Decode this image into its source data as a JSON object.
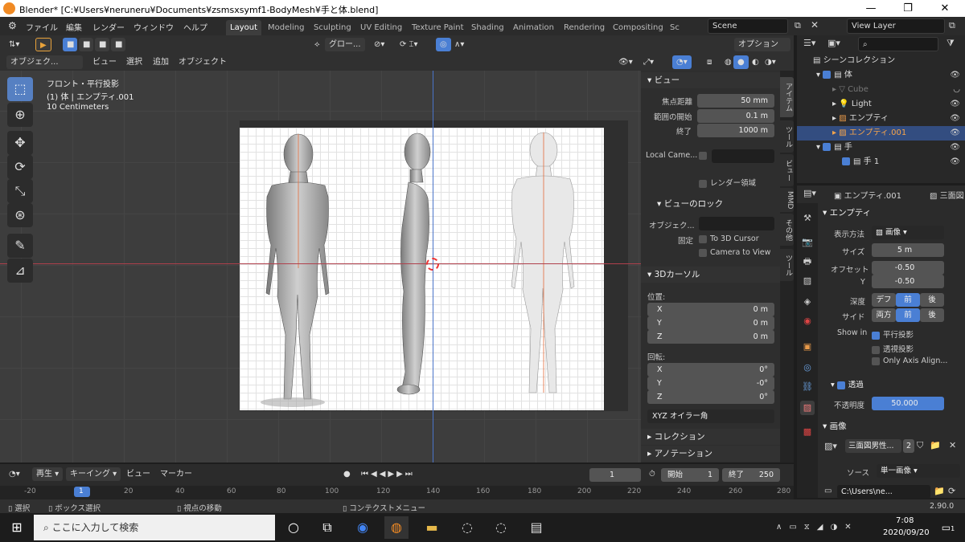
{
  "window": {
    "title": "Blender* [C:¥Users¥neruneru¥Documents¥zsmsxsymf1-BodyMesh¥手と体.blend]",
    "minimize": "—",
    "maximize": "❐",
    "close": "✕"
  },
  "menus": [
    "ファイル",
    "編集",
    "レンダー",
    "ウィンドウ",
    "ヘルプ"
  ],
  "workspaces": [
    "Layout",
    "Modeling",
    "Sculpting",
    "UV Editing",
    "Texture Paint",
    "Shading",
    "Animation",
    "Rendering",
    "Compositing",
    "Sc"
  ],
  "scene": "Scene",
  "view_layer": "View Layer",
  "vp_header": {
    "transform": "グロー...",
    "options": "オプション"
  },
  "vp_header2": {
    "mode": "オブジェク...",
    "items": [
      "ビュー",
      "選択",
      "追加",
      "オブジェクト"
    ]
  },
  "viewport": {
    "view_name": "フロント・平行投影",
    "object": "(1) 体 | エンプティ.001",
    "scale": "10 Centimeters"
  },
  "npanel": {
    "view_title": "ビュー",
    "focal_label": "焦点距離",
    "focal": "50 mm",
    "clip_start_label": "範囲の開始",
    "clip_start": "0.1 m",
    "clip_end_label": "終了",
    "clip_end": "1000 m",
    "local_camera": "Local Came...",
    "render_region": "レンダー領域",
    "view_lock": "ビューのロック",
    "lock_object": "オブジェク...",
    "lock_label": "固定",
    "to_cursor": "To 3D Cursor",
    "cam_to_view": "Camera to View",
    "cursor_title": "3Dカーソル",
    "location": "位置:",
    "x": "X",
    "y": "Y",
    "z": "Z",
    "loc_x": "0 m",
    "loc_y": "0 m",
    "loc_z": "0 m",
    "rotation": "回転:",
    "rot_x": "0°",
    "rot_y": "-0°",
    "rot_z": "0°",
    "rot_mode": "XYZ オイラー角",
    "collection": "コレクション",
    "annotation": "アノテーション"
  },
  "ntabs": [
    "アイテム",
    "ツール",
    "ビュー",
    "MMD",
    "その他",
    "ツール"
  ],
  "outliner": {
    "root": "シーンコレクション",
    "items": [
      "体",
      "Cube",
      "Light",
      "エンプティ",
      "エンプティ.001",
      "手",
      "手 1"
    ]
  },
  "props": {
    "object": "エンプティ.001",
    "image_tab": "三面図",
    "section": "エンプティ",
    "display_label": "表示方法",
    "display": "画像",
    "size_label": "サイズ",
    "size": "5 m",
    "offset_label": "オフセット",
    "offset_x": "-0.50",
    "offset_y_label": "Y",
    "offset_y": "-0.50",
    "depth_label": "深度",
    "depth": [
      "デフ",
      "前",
      "後"
    ],
    "side_label": "サイド",
    "side": [
      "両方",
      "前",
      "後"
    ],
    "show_in": "Show in",
    "ortho": "平行投影",
    "persp": "透視投影",
    "axis_aligned": "Only Axis Align...",
    "transp": "透過",
    "opacity_label": "不透明度",
    "opacity": "50.000",
    "image_section": "画像",
    "image_name": "三面図男性...",
    "image_users": "2",
    "source_label": "ソース",
    "source": "単一画像",
    "path": "C:\\Users\\ne..."
  },
  "timeline": {
    "playback": "再生",
    "keying": "キーイング",
    "view": "ビュー",
    "marker": "マーカー",
    "frame": "1",
    "start_label": "開始",
    "start": "1",
    "end_label": "終了",
    "end": "250",
    "ticks": [
      "-20",
      "1",
      "20",
      "40",
      "60",
      "80",
      "100",
      "120",
      "140",
      "160",
      "180",
      "200",
      "220",
      "240",
      "260",
      "280"
    ]
  },
  "statusbar": {
    "select": "選択",
    "box": "ボックス選択",
    "move": "視点の移動",
    "context": "コンテクストメニュー",
    "version": "2.90.0"
  },
  "taskbar": {
    "search": "ここに入力して検索",
    "time": "7:08",
    "date": "2020/09/20",
    "notif": "1"
  }
}
